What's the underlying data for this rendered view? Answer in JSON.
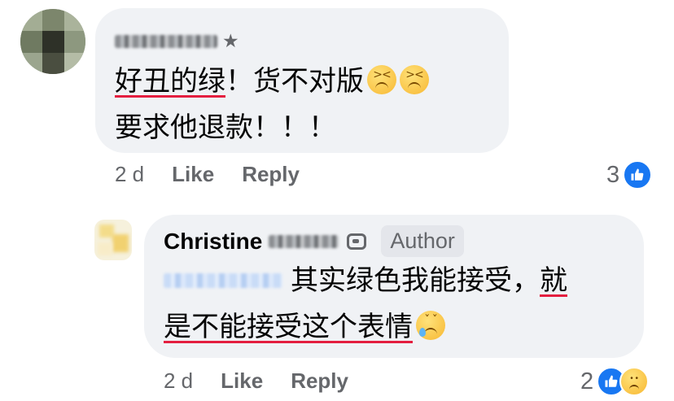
{
  "comments": [
    {
      "author_visible": "",
      "line1_under": "好丑的绿",
      "line1_rest": "！货不对版",
      "line2": "要求他退款！！！",
      "time": "2 d",
      "like_label": "Like",
      "reply_label": "Reply",
      "reaction_count": "3",
      "icons": [
        "star-icon",
        "confounded-face-emoji",
        "like-reaction-icon"
      ]
    },
    {
      "author_first": "Christine",
      "author_badge": "Author",
      "line1_text": "其实绿色我能接受，",
      "line1_under": "就",
      "line2_under": "是不能接受这个表情",
      "time": "2 d",
      "like_label": "Like",
      "reply_label": "Reply",
      "reaction_count": "2",
      "icons": [
        "messenger-icon",
        "crying-face-emoji",
        "like-reaction-icon",
        "sad-reaction-icon"
      ]
    }
  ],
  "colors": {
    "bubble": "#f0f2f5",
    "meta_text": "#65676b",
    "underline": "#e41e3f",
    "like_blue": "#1877f2"
  }
}
